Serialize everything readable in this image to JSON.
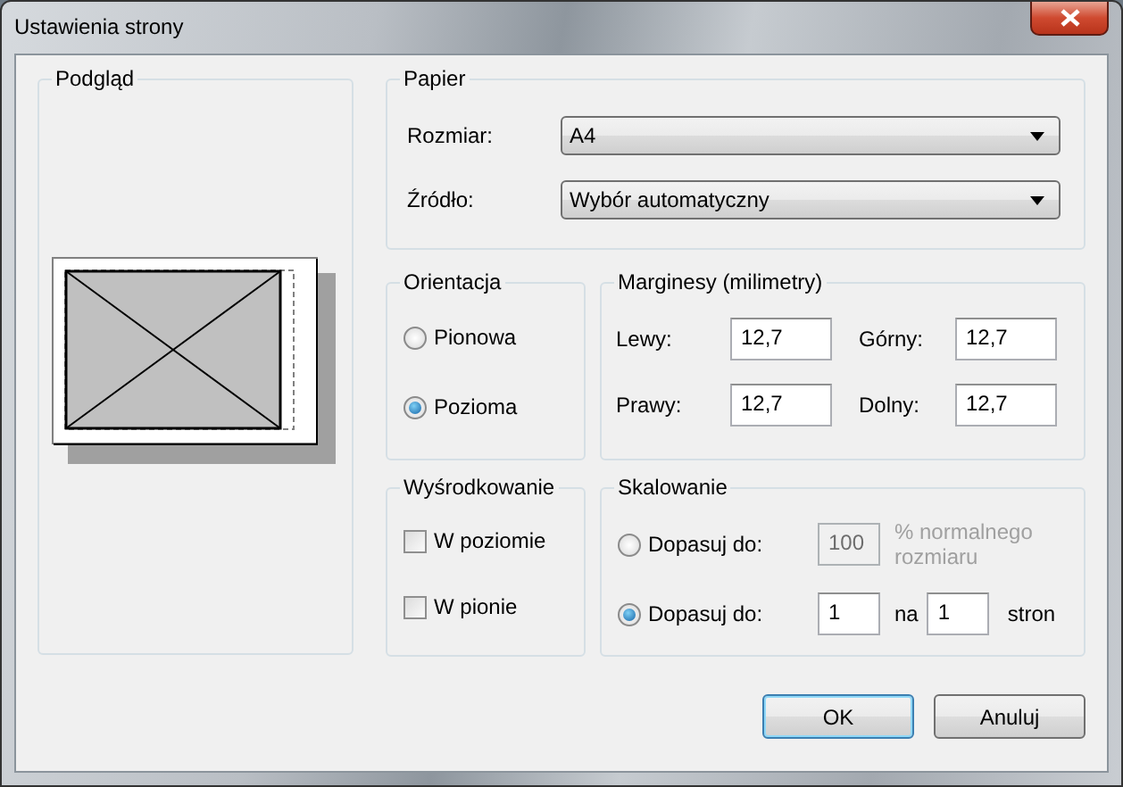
{
  "window": {
    "title": "Ustawienia strony"
  },
  "preview": {
    "title": "Podgląd"
  },
  "paper": {
    "title": "Papier",
    "fields": [
      {
        "label": "Rozmiar:",
        "value": "A4"
      },
      {
        "label": "Źródło:",
        "value": "Wybór automatyczny"
      }
    ]
  },
  "orientation": {
    "title": "Orientacja",
    "options": [
      {
        "label": "Pionowa",
        "selected": false
      },
      {
        "label": "Pozioma",
        "selected": true
      }
    ]
  },
  "margins": {
    "title": "Marginesy (milimetry)",
    "fields": [
      {
        "label": "Lewy:",
        "value": "12,7"
      },
      {
        "label": "Górny:",
        "value": "12,7"
      },
      {
        "label": "Prawy:",
        "value": "12,7"
      },
      {
        "label": "Dolny:",
        "value": "12,7"
      }
    ]
  },
  "centering": {
    "title": "Wyśrodkowanie",
    "options": [
      {
        "label": "W poziomie",
        "checked": false
      },
      {
        "label": "W pionie",
        "checked": false
      }
    ]
  },
  "scaling": {
    "title": "Skalowanie",
    "options": [
      {
        "kind": "percent",
        "label": "Dopasuj do:",
        "selected": false,
        "disabled": true,
        "value": "100",
        "suffix": "% normalnego rozmiaru"
      },
      {
        "kind": "fit",
        "label": "Dopasuj do:",
        "selected": true,
        "disabled": false,
        "wide": "1",
        "joiner": "na",
        "tall": "1",
        "suffix": "stron"
      }
    ]
  },
  "buttons": [
    {
      "label": "OK",
      "default": true
    },
    {
      "label": "Anuluj",
      "default": false
    }
  ]
}
